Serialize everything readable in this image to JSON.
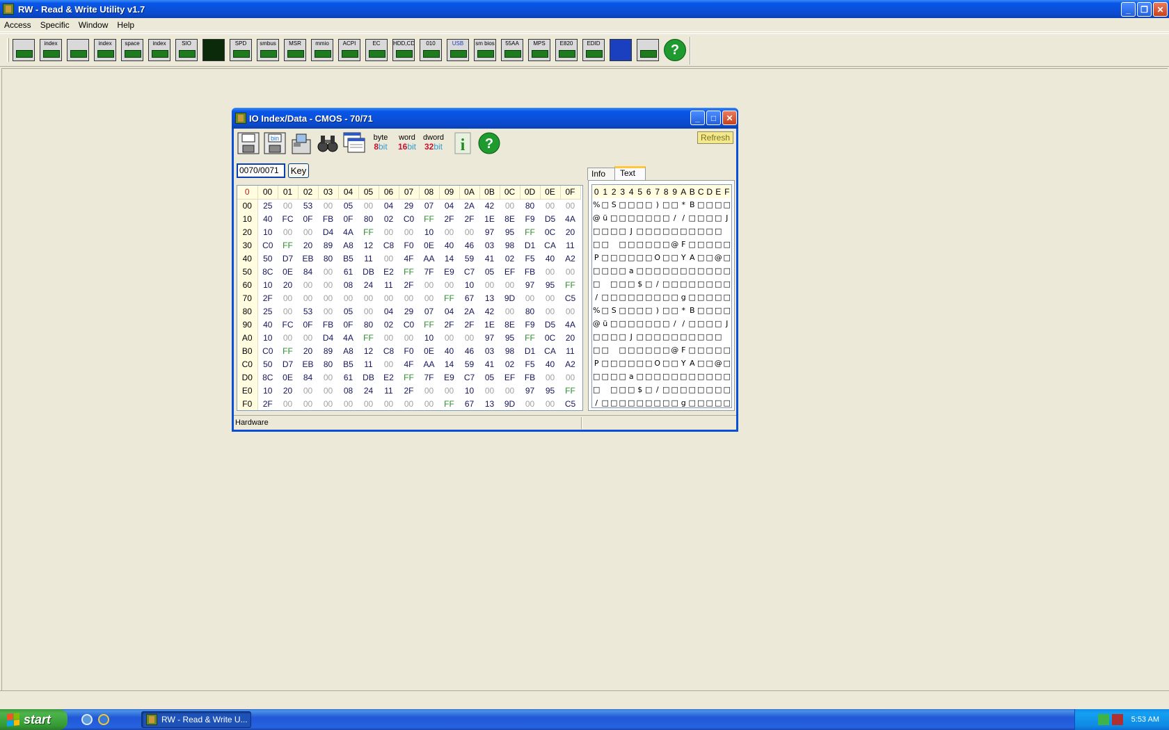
{
  "window": {
    "title": "RW - Read & Write Utility v1.7",
    "minimize": "_",
    "restore": "❐",
    "close": "✕"
  },
  "menu": [
    "Access",
    "Specific",
    "Window",
    "Help"
  ],
  "toolbar": [
    {
      "name": "pci-icon",
      "label": ""
    },
    {
      "name": "io-index-icon",
      "label": "index"
    },
    {
      "name": "memory-icon",
      "label": ""
    },
    {
      "name": "memory-index-icon",
      "label": "index"
    },
    {
      "name": "io-space-icon",
      "label": "space"
    },
    {
      "name": "io-index2-icon",
      "label": "index"
    },
    {
      "name": "sio-icon",
      "label": "SIO"
    },
    {
      "name": "waveform-icon",
      "label": ""
    },
    {
      "name": "spd-icon",
      "label": "SPD"
    },
    {
      "name": "smbus-icon",
      "label": "smbus"
    },
    {
      "name": "msr-icon",
      "label": "MSR"
    },
    {
      "name": "mmio-icon",
      "label": "mmio"
    },
    {
      "name": "acpi-icon",
      "label": "ACPI"
    },
    {
      "name": "ec-icon",
      "label": "EC"
    },
    {
      "name": "hdd-cd-icon",
      "label": "HDD,CD"
    },
    {
      "name": "io-010-icon",
      "label": "010"
    },
    {
      "name": "usb-icon",
      "label": "USB"
    },
    {
      "name": "smbios-icon",
      "label": "sm bios"
    },
    {
      "name": "55aa-icon",
      "label": "55AA"
    },
    {
      "name": "mps-icon",
      "label": "MPS"
    },
    {
      "name": "e820-icon",
      "label": "E820"
    },
    {
      "name": "edid-icon",
      "label": "EDID"
    },
    {
      "name": "command-window-icon",
      "label": ""
    },
    {
      "name": "server-icon",
      "label": ""
    },
    {
      "name": "help-icon",
      "label": "?"
    }
  ],
  "child": {
    "title": "IO Index/Data - CMOS - 70/71",
    "toolbar": {
      "byte": {
        "top": "byte",
        "num": "8",
        "bit": "bit"
      },
      "word": {
        "top": "word",
        "num": "16",
        "bit": "bit"
      },
      "dword": {
        "top": "dword",
        "num": "32",
        "bit": "bit"
      },
      "info": "i",
      "help": "?",
      "bin": "bin"
    },
    "refresh_label": "Refresh",
    "address": "0070/0071",
    "key_label": "Key",
    "status": "Hardware",
    "tabs": {
      "info": "Info",
      "text": "Text"
    }
  },
  "hex": {
    "corner": "0",
    "columns": [
      "00",
      "01",
      "02",
      "03",
      "04",
      "05",
      "06",
      "07",
      "08",
      "09",
      "0A",
      "0B",
      "0C",
      "0D",
      "0E",
      "0F"
    ],
    "rows": [
      {
        "addr": "00",
        "cells": [
          "25",
          "00",
          "53",
          "00",
          "05",
          "00",
          "04",
          "29",
          "07",
          "04",
          "2A",
          "42",
          "00",
          "80",
          "00",
          "00"
        ]
      },
      {
        "addr": "10",
        "cells": [
          "40",
          "FC",
          "0F",
          "FB",
          "0F",
          "80",
          "02",
          "C0",
          "FF",
          "2F",
          "2F",
          "1E",
          "8E",
          "F9",
          "D5",
          "4A"
        ]
      },
      {
        "addr": "20",
        "cells": [
          "10",
          "00",
          "00",
          "D4",
          "4A",
          "FF",
          "00",
          "00",
          "10",
          "00",
          "00",
          "97",
          "95",
          "FF",
          "0C",
          "20"
        ]
      },
      {
        "addr": "30",
        "cells": [
          "C0",
          "FF",
          "20",
          "89",
          "A8",
          "12",
          "C8",
          "F0",
          "0E",
          "40",
          "46",
          "03",
          "98",
          "D1",
          "CA",
          "11"
        ]
      },
      {
        "addr": "40",
        "cells": [
          "50",
          "D7",
          "EB",
          "80",
          "B5",
          "11",
          "00",
          "4F",
          "AA",
          "14",
          "59",
          "41",
          "02",
          "F5",
          "40",
          "A2"
        ]
      },
      {
        "addr": "50",
        "cells": [
          "8C",
          "0E",
          "84",
          "00",
          "61",
          "DB",
          "E2",
          "FF",
          "7F",
          "E9",
          "C7",
          "05",
          "EF",
          "FB",
          "00",
          "00"
        ]
      },
      {
        "addr": "60",
        "cells": [
          "10",
          "20",
          "00",
          "00",
          "08",
          "24",
          "11",
          "2F",
          "00",
          "00",
          "10",
          "00",
          "00",
          "97",
          "95",
          "FF"
        ]
      },
      {
        "addr": "70",
        "cells": [
          "2F",
          "00",
          "00",
          "00",
          "00",
          "00",
          "00",
          "00",
          "00",
          "FF",
          "67",
          "13",
          "9D",
          "00",
          "00",
          "C5"
        ]
      },
      {
        "addr": "80",
        "cells": [
          "25",
          "00",
          "53",
          "00",
          "05",
          "00",
          "04",
          "29",
          "07",
          "04",
          "2A",
          "42",
          "00",
          "80",
          "00",
          "00"
        ]
      },
      {
        "addr": "90",
        "cells": [
          "40",
          "FC",
          "0F",
          "FB",
          "0F",
          "80",
          "02",
          "C0",
          "FF",
          "2F",
          "2F",
          "1E",
          "8E",
          "F9",
          "D5",
          "4A"
        ]
      },
      {
        "addr": "A0",
        "cells": [
          "10",
          "00",
          "00",
          "D4",
          "4A",
          "FF",
          "00",
          "00",
          "10",
          "00",
          "00",
          "97",
          "95",
          "FF",
          "0C",
          "20"
        ]
      },
      {
        "addr": "B0",
        "cells": [
          "C0",
          "FF",
          "20",
          "89",
          "A8",
          "12",
          "C8",
          "F0",
          "0E",
          "40",
          "46",
          "03",
          "98",
          "D1",
          "CA",
          "11"
        ]
      },
      {
        "addr": "C0",
        "cells": [
          "50",
          "D7",
          "EB",
          "80",
          "B5",
          "11",
          "00",
          "4F",
          "AA",
          "14",
          "59",
          "41",
          "02",
          "F5",
          "40",
          "A2"
        ]
      },
      {
        "addr": "D0",
        "cells": [
          "8C",
          "0E",
          "84",
          "00",
          "61",
          "DB",
          "E2",
          "FF",
          "7F",
          "E9",
          "C7",
          "05",
          "EF",
          "FB",
          "00",
          "00"
        ]
      },
      {
        "addr": "E0",
        "cells": [
          "10",
          "20",
          "00",
          "00",
          "08",
          "24",
          "11",
          "2F",
          "00",
          "00",
          "10",
          "00",
          "00",
          "97",
          "95",
          "FF"
        ]
      },
      {
        "addr": "F0",
        "cells": [
          "2F",
          "00",
          "00",
          "00",
          "00",
          "00",
          "00",
          "00",
          "00",
          "FF",
          "67",
          "13",
          "9D",
          "00",
          "00",
          "C5"
        ]
      }
    ]
  },
  "text_view": {
    "columns": [
      "0",
      "1",
      "2",
      "3",
      "4",
      "5",
      "6",
      "7",
      "8",
      "9",
      "A",
      "B",
      "C",
      "D",
      "E",
      "F"
    ],
    "rows": [
      [
        "%",
        "□",
        "S",
        "□",
        "□",
        "□",
        "□",
        ")",
        "□",
        "□",
        "*",
        "B",
        "□",
        "□",
        "□",
        "□"
      ],
      [
        "@",
        "ü",
        "□",
        "□",
        "□",
        "□",
        "□",
        "□",
        "□",
        "/",
        "/",
        "□",
        "□",
        "□",
        "□",
        "J"
      ],
      [
        "□",
        "□",
        "□",
        "□",
        "J",
        "□",
        "□",
        "□",
        "□",
        "□",
        "□",
        "□",
        "□",
        "□",
        "□",
        ""
      ],
      [
        "□",
        "□",
        "",
        "□",
        "□",
        "□",
        "□",
        "□",
        "□",
        "@",
        "F",
        "□",
        "□",
        "□",
        "□",
        "□"
      ],
      [
        "P",
        "□",
        "□",
        "□",
        "□",
        "□",
        "□",
        "O",
        "□",
        "□",
        "Y",
        "A",
        "□",
        "□",
        "@",
        "□"
      ],
      [
        "□",
        "□",
        "□",
        "□",
        "a",
        "□",
        "□",
        "□",
        "□",
        "□",
        "□",
        "□",
        "□",
        "□",
        "□",
        "□"
      ],
      [
        "□",
        "",
        "□",
        "□",
        "□",
        "$",
        "□",
        "/",
        "□",
        "□",
        "□",
        "□",
        "□",
        "□",
        "□",
        "□"
      ],
      [
        "/",
        "□",
        "□",
        "□",
        "□",
        "□",
        "□",
        "□",
        "□",
        "□",
        "g",
        "□",
        "□",
        "□",
        "□",
        "□"
      ],
      [
        "%",
        "□",
        "S",
        "□",
        "□",
        "□",
        "□",
        ")",
        "□",
        "□",
        "*",
        "B",
        "□",
        "□",
        "□",
        "□"
      ],
      [
        "@",
        "ü",
        "□",
        "□",
        "□",
        "□",
        "□",
        "□",
        "□",
        "/",
        "/",
        "□",
        "□",
        "□",
        "□",
        "J"
      ],
      [
        "□",
        "□",
        "□",
        "□",
        "J",
        "□",
        "□",
        "□",
        "□",
        "□",
        "□",
        "□",
        "□",
        "□",
        "□",
        ""
      ],
      [
        "□",
        "□",
        "",
        "□",
        "□",
        "□",
        "□",
        "□",
        "□",
        "@",
        "F",
        "□",
        "□",
        "□",
        "□",
        "□"
      ],
      [
        "P",
        "□",
        "□",
        "□",
        "□",
        "□",
        "□",
        "O",
        "□",
        "□",
        "Y",
        "A",
        "□",
        "□",
        "@",
        "□"
      ],
      [
        "□",
        "□",
        "□",
        "□",
        "a",
        "□",
        "□",
        "□",
        "□",
        "□",
        "□",
        "□",
        "□",
        "□",
        "□",
        "□"
      ],
      [
        "□",
        "",
        "□",
        "□",
        "□",
        "$",
        "□",
        "/",
        "□",
        "□",
        "□",
        "□",
        "□",
        "□",
        "□",
        "□"
      ],
      [
        "/",
        "□",
        "□",
        "□",
        "□",
        "□",
        "□",
        "□",
        "□",
        "□",
        "g",
        "□",
        "□",
        "□",
        "□",
        "□"
      ]
    ]
  },
  "taskbar": {
    "start": "start",
    "task_label": "RW - Read & Write U...",
    "clock": "5:53 AM"
  }
}
